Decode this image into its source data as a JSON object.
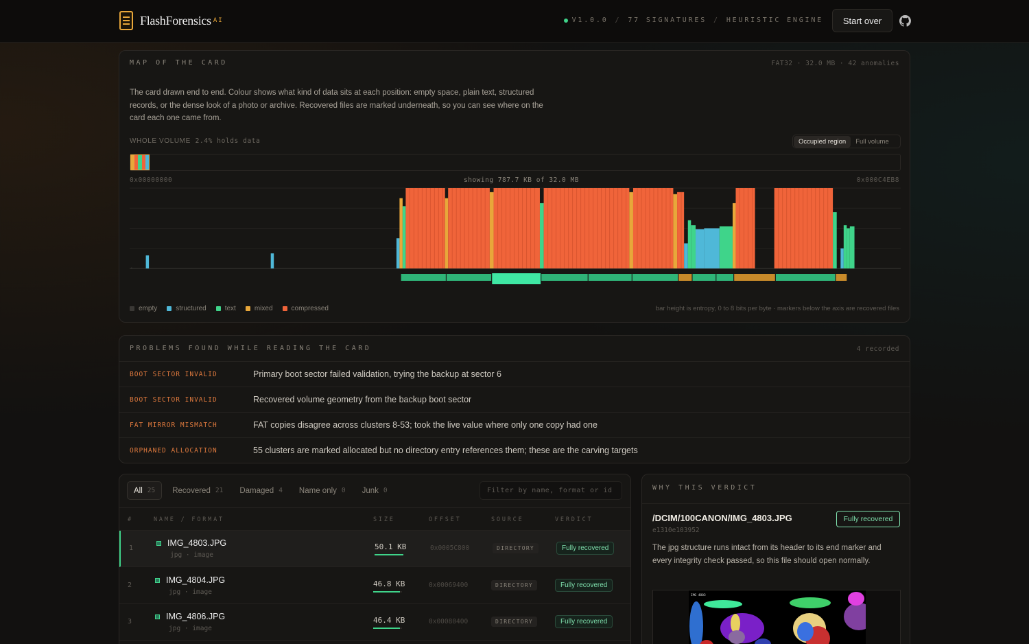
{
  "header": {
    "brand": "FlashForensics",
    "brand_sup": "AI",
    "version": "V1.0.0",
    "signatures": "77 SIGNATURES",
    "engine": "HEURISTIC ENGINE",
    "start_over": "Start over"
  },
  "map": {
    "title": "MAP OF THE CARD",
    "meta": "FAT32 · 32.0 MB · 42 anomalies",
    "description": "The card drawn end to end. Colour shows what kind of data sits at each position: empty space, plain text, structured records, or the dense look of a photo or archive. Recovered files are marked underneath, so you can see where on the card each one came from.",
    "whole_volume_label": "WHOLE VOLUME",
    "whole_volume_value": "2.4% holds data",
    "toggle_occupied": "Occupied region",
    "toggle_full": "Full volume",
    "addr_start": "0x00000000",
    "showing": "showing 787.7 KB of 32.0 MB",
    "addr_end": "0x000C4EB8",
    "legend": [
      {
        "label": "empty",
        "color": "#3a3835"
      },
      {
        "label": "structured",
        "color": "#4fb8d8"
      },
      {
        "label": "text",
        "color": "#3fd48a"
      },
      {
        "label": "mixed",
        "color": "#e8a73a"
      },
      {
        "label": "compressed",
        "color": "#f0643a"
      }
    ],
    "note": "bar height is entropy, 0 to 8 bits per byte · markers below the axis are recovered files"
  },
  "chart_data": {
    "type": "bar",
    "title": "",
    "xlabel": "",
    "ylabel": "",
    "ylim": [
      0,
      8
    ],
    "x_range": [
      "0x00000000",
      "0x000C4EB8"
    ],
    "segments": [
      {
        "start": 0.002,
        "end": 0.003,
        "entropy": 0.1,
        "kind": "empty"
      },
      {
        "start": 0.021,
        "end": 0.025,
        "entropy": 1.3,
        "kind": "structured"
      },
      {
        "start": 0.183,
        "end": 0.187,
        "entropy": 1.5,
        "kind": "structured"
      },
      {
        "start": 0.346,
        "end": 0.35,
        "entropy": 3.0,
        "kind": "structured"
      },
      {
        "start": 0.35,
        "end": 0.354,
        "entropy": 7.0,
        "kind": "mixed"
      },
      {
        "start": 0.354,
        "end": 0.358,
        "entropy": 6.2,
        "kind": "text"
      },
      {
        "start": 0.358,
        "end": 0.409,
        "entropy": 8.0,
        "kind": "compressed"
      },
      {
        "start": 0.409,
        "end": 0.413,
        "entropy": 7.0,
        "kind": "mixed"
      },
      {
        "start": 0.413,
        "end": 0.467,
        "entropy": 8.0,
        "kind": "compressed"
      },
      {
        "start": 0.467,
        "end": 0.472,
        "entropy": 7.6,
        "kind": "mixed"
      },
      {
        "start": 0.472,
        "end": 0.532,
        "entropy": 8.0,
        "kind": "compressed"
      },
      {
        "start": 0.532,
        "end": 0.537,
        "entropy": 6.5,
        "kind": "text"
      },
      {
        "start": 0.537,
        "end": 0.648,
        "entropy": 8.0,
        "kind": "compressed"
      },
      {
        "start": 0.648,
        "end": 0.653,
        "entropy": 7.6,
        "kind": "mixed"
      },
      {
        "start": 0.653,
        "end": 0.705,
        "entropy": 8.0,
        "kind": "compressed"
      },
      {
        "start": 0.705,
        "end": 0.71,
        "entropy": 7.4,
        "kind": "mixed"
      },
      {
        "start": 0.71,
        "end": 0.719,
        "entropy": 7.6,
        "kind": "compressed"
      },
      {
        "start": 0.719,
        "end": 0.724,
        "entropy": 2.5,
        "kind": "structured"
      },
      {
        "start": 0.724,
        "end": 0.728,
        "entropy": 4.8,
        "kind": "text"
      },
      {
        "start": 0.728,
        "end": 0.734,
        "entropy": 4.3,
        "kind": "text"
      },
      {
        "start": 0.734,
        "end": 0.745,
        "entropy": 3.9,
        "kind": "structured"
      },
      {
        "start": 0.745,
        "end": 0.765,
        "entropy": 4.0,
        "kind": "structured"
      },
      {
        "start": 0.765,
        "end": 0.782,
        "entropy": 4.2,
        "kind": "text"
      },
      {
        "start": 0.782,
        "end": 0.786,
        "entropy": 6.5,
        "kind": "mixed"
      },
      {
        "start": 0.786,
        "end": 0.811,
        "entropy": 8.0,
        "kind": "compressed"
      },
      {
        "start": 0.836,
        "end": 0.912,
        "entropy": 8.0,
        "kind": "compressed"
      },
      {
        "start": 0.912,
        "end": 0.917,
        "entropy": 5.6,
        "kind": "text"
      },
      {
        "start": 0.922,
        "end": 0.926,
        "entropy": 2.0,
        "kind": "structured"
      },
      {
        "start": 0.926,
        "end": 0.93,
        "entropy": 4.3,
        "kind": "text"
      },
      {
        "start": 0.93,
        "end": 0.934,
        "entropy": 4.0,
        "kind": "text"
      },
      {
        "start": 0.934,
        "end": 0.94,
        "entropy": 4.2,
        "kind": "text"
      }
    ],
    "recovered_markers": [
      {
        "start": 0.352,
        "end": 0.41,
        "kind": "text"
      },
      {
        "start": 0.411,
        "end": 0.469,
        "kind": "text"
      },
      {
        "start": 0.47,
        "end": 0.533,
        "kind": "text",
        "selected": true
      },
      {
        "start": 0.534,
        "end": 0.594,
        "kind": "text"
      },
      {
        "start": 0.595,
        "end": 0.651,
        "kind": "text"
      },
      {
        "start": 0.652,
        "end": 0.711,
        "kind": "text"
      },
      {
        "start": 0.712,
        "end": 0.729,
        "kind": "mixed"
      },
      {
        "start": 0.73,
        "end": 0.76,
        "kind": "text"
      },
      {
        "start": 0.761,
        "end": 0.783,
        "kind": "text"
      },
      {
        "start": 0.784,
        "end": 0.837,
        "kind": "mixed"
      },
      {
        "start": 0.838,
        "end": 0.915,
        "kind": "text"
      },
      {
        "start": 0.916,
        "end": 0.93,
        "kind": "mixed"
      }
    ]
  },
  "problems": {
    "title": "PROBLEMS FOUND WHILE READING THE CARD",
    "count": "4 recorded",
    "rows": [
      {
        "code": "BOOT SECTOR INVALID",
        "message": "Primary boot sector failed validation, trying the backup at sector 6"
      },
      {
        "code": "BOOT SECTOR INVALID",
        "message": "Recovered volume geometry from the backup boot sector"
      },
      {
        "code": "FAT MIRROR MISMATCH",
        "message": "FAT copies disagree across clusters 8-53; took the live value where only one copy had one"
      },
      {
        "code": "ORPHANED ALLOCATION",
        "message": "55 clusters are marked allocated but no directory entry references them; these are the carving targets"
      }
    ]
  },
  "files": {
    "tabs": [
      {
        "label": "All",
        "count": "25"
      },
      {
        "label": "Recovered",
        "count": "21"
      },
      {
        "label": "Damaged",
        "count": "4"
      },
      {
        "label": "Name only",
        "count": "0"
      },
      {
        "label": "Junk",
        "count": "0"
      }
    ],
    "filter_placeholder": "Filter by name, format or id",
    "columns": {
      "num": "#",
      "name": "NAME / FORMAT",
      "size": "SIZE",
      "offset": "OFFSET",
      "source": "SOURCE",
      "verdict": "VERDICT"
    },
    "rows": [
      {
        "num": "1",
        "name": "IMG_4803.JPG",
        "type": "jpg · image",
        "size": "50.1 KB",
        "size_fraction": 1.0,
        "offset": "0x0005C800",
        "source": "DIRECTORY",
        "verdict": "Fully recovered"
      },
      {
        "num": "2",
        "name": "IMG_4804.JPG",
        "type": "jpg · image",
        "size": "46.8 KB",
        "size_fraction": 0.93,
        "offset": "0x00069400",
        "source": "DIRECTORY",
        "verdict": "Fully recovered"
      },
      {
        "num": "3",
        "name": "IMG_4806.JPG",
        "type": "jpg · image",
        "size": "46.4 KB",
        "size_fraction": 0.93,
        "offset": "0x00080400",
        "source": "DIRECTORY",
        "verdict": "Fully recovered"
      }
    ]
  },
  "verdict": {
    "title": "WHY THIS VERDICT",
    "path": "/DCIM/100CANON/IMG_4803.JPG",
    "id": "e1310e103952",
    "badge": "Fully recovered",
    "text": "The jpg structure runs intact from its header to its end marker and every integrity check passed, so this file should open normally.",
    "preview_label": "IMG 4803"
  }
}
